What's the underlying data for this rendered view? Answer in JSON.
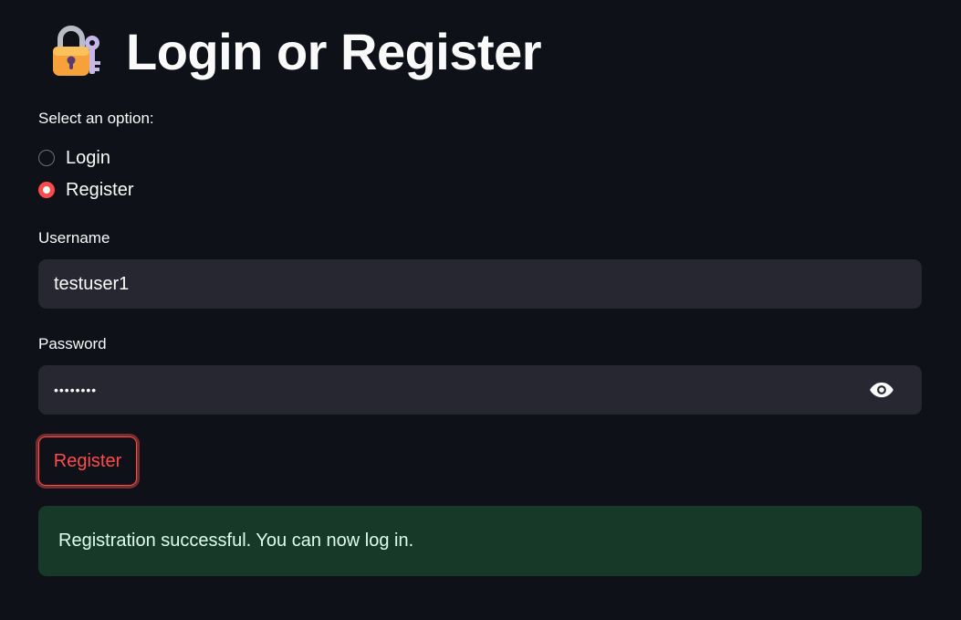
{
  "header": {
    "title": "Login or Register",
    "icon": "lock-with-key-icon"
  },
  "option_group": {
    "label": "Select an option:",
    "options": [
      {
        "label": "Login",
        "selected": false
      },
      {
        "label": "Register",
        "selected": true
      }
    ]
  },
  "form": {
    "username": {
      "label": "Username",
      "value": "testuser1"
    },
    "password": {
      "label": "Password",
      "masked_value": "••••••••",
      "toggle_icon": "eye-icon"
    },
    "submit_label": "Register"
  },
  "alert": {
    "type": "success",
    "message": "Registration successful. You can now log in."
  },
  "colors": {
    "background": "#0e1117",
    "input_bg": "#262730",
    "accent": "#ff4b4b",
    "success_bg": "#173928",
    "success_text": "#dffde9"
  }
}
